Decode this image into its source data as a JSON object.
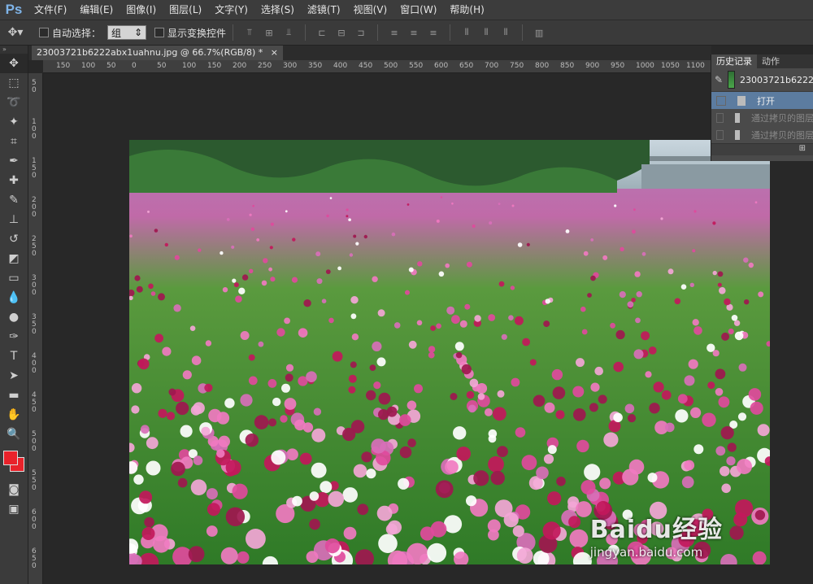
{
  "app": {
    "logo": "Ps"
  },
  "menu": [
    "文件(F)",
    "编辑(E)",
    "图像(I)",
    "图层(L)",
    "文字(Y)",
    "选择(S)",
    "滤镜(T)",
    "视图(V)",
    "窗口(W)",
    "帮助(H)"
  ],
  "options": {
    "auto_select_label": "自动选择：",
    "auto_select_value": "组",
    "show_transform_label": "显示变换控件"
  },
  "document_tab": {
    "title": "23003721b6222abx1uahnu.jpg @ 66.7%(RGB/8) *",
    "close": "×"
  },
  "ruler": {
    "h_ticks": [
      "150",
      "100",
      "50",
      "0",
      "50",
      "100",
      "150",
      "200",
      "250",
      "300",
      "350",
      "400",
      "450",
      "500",
      "550",
      "600",
      "650",
      "700",
      "750",
      "800",
      "850",
      "900",
      "950",
      "1000",
      "1050",
      "1100"
    ],
    "v_ticks": [
      "5 0",
      "1 0 0",
      "1 5 0",
      "2 0 0",
      "2 5 0",
      "3 0 0",
      "3 5 0",
      "4 0 0",
      "4 5 0",
      "5 0 0",
      "5 5 0",
      "6 0 0",
      "6 5 0",
      "7 0 0"
    ]
  },
  "history": {
    "tabs": [
      "历史记录",
      "动作"
    ],
    "snapshot": "23003721b6222",
    "items": [
      {
        "label": "打开",
        "state": "active"
      },
      {
        "label": "通过拷贝的图层",
        "state": "disabled"
      },
      {
        "label": "通过拷贝的图层",
        "state": "disabled"
      }
    ]
  },
  "colors": {
    "foreground": "#e8222a",
    "background": "#e8222a",
    "accent": "#5c7ca0"
  },
  "watermark": {
    "main": "Baidu经验",
    "sub": "jingyan.baidu.com"
  }
}
